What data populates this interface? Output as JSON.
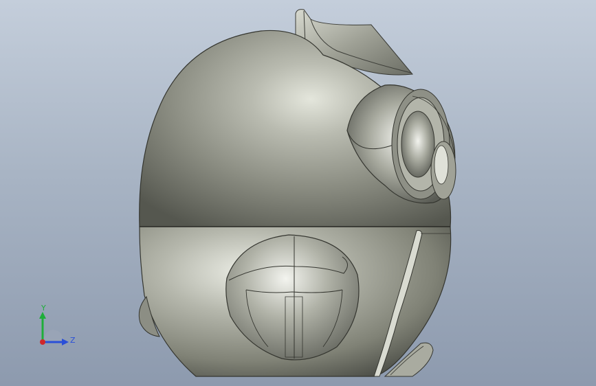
{
  "viewport": {
    "background_top": "#c4cedb",
    "background_bottom": "#8d9aae",
    "model_color": "#9a9c90"
  },
  "triad": {
    "y_label": "Y",
    "z_label": "Z",
    "y_color": "#1fae3a",
    "z_color": "#2a4fd8",
    "x_color": "#d0272a"
  }
}
